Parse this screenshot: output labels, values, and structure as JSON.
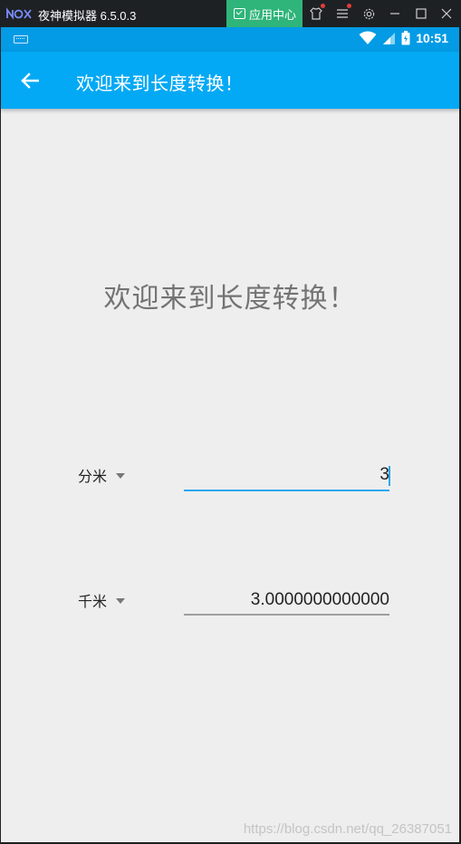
{
  "emulator": {
    "title": "夜神模拟器 6.5.0.3",
    "app_center_label": "应用中心",
    "icons": [
      "shirt-icon",
      "menu-icon",
      "settings-icon",
      "minimize-icon",
      "maximize-icon",
      "close-icon"
    ]
  },
  "status_bar": {
    "time": "10:51",
    "icons": [
      "keyboard-icon",
      "wifi-icon",
      "signal-icon",
      "battery-icon"
    ]
  },
  "app_bar": {
    "title": "欢迎来到长度转换！",
    "back_icon": "arrow-left-icon"
  },
  "main": {
    "heading": "欢迎来到长度转换！",
    "from": {
      "unit": "分米",
      "value": "3"
    },
    "to": {
      "unit": "千米",
      "value": "3.0000000000000"
    }
  },
  "watermark": "https://blog.csdn.net/qq_26387051",
  "colors": {
    "app_bar": "#03a9f4",
    "status_bar": "#039be5",
    "accent": "#29a8f0",
    "background": "#eeeeee",
    "app_center": "#2fb47a"
  }
}
